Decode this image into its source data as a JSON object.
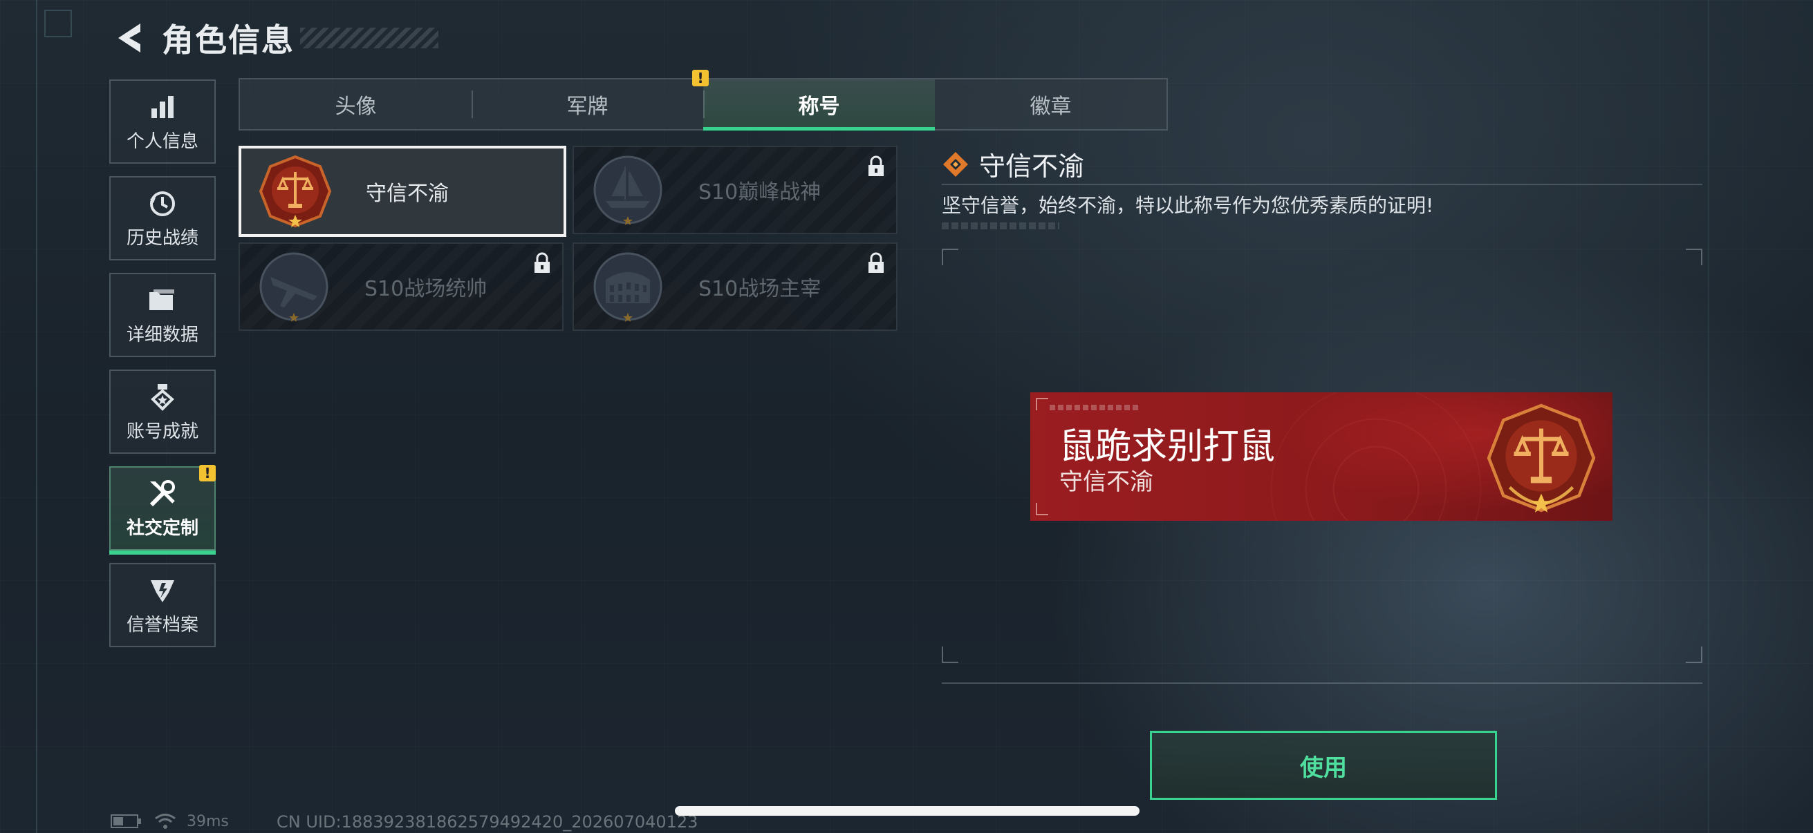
{
  "header": {
    "title": "角色信息"
  },
  "nav": {
    "items": [
      {
        "label": "个人信息",
        "icon": "bar-chart-icon",
        "active": false
      },
      {
        "label": "历史战绩",
        "icon": "history-clock-icon",
        "active": false
      },
      {
        "label": "详细数据",
        "icon": "folder-icon",
        "active": false
      },
      {
        "label": "账号成就",
        "icon": "achievement-icon",
        "active": false
      },
      {
        "label": "社交定制",
        "icon": "tools-icon",
        "active": true,
        "alert": "!"
      },
      {
        "label": "信誉档案",
        "icon": "credit-shield-icon",
        "active": false
      }
    ]
  },
  "tabs": [
    {
      "label": "头像",
      "active": false
    },
    {
      "label": "军牌",
      "active": false,
      "alert": "!"
    },
    {
      "label": "称号",
      "active": true
    },
    {
      "label": "徽章",
      "active": false
    }
  ],
  "titles": [
    {
      "label": "守信不渝",
      "emblem": "scales-emblem-icon",
      "locked": false,
      "selected": true
    },
    {
      "label": "S10巅峰战神",
      "emblem": "ship-emblem-icon",
      "locked": true,
      "selected": false
    },
    {
      "label": "S10战场统帅",
      "emblem": "plane-emblem-icon",
      "locked": true,
      "selected": false
    },
    {
      "label": "S10战场主宰",
      "emblem": "colosseum-emblem-icon",
      "locked": true,
      "selected": false
    }
  ],
  "detail": {
    "title": "守信不渝",
    "description": "坚守信誉，始终不渝，特以此称号作为您优秀素质的证明!"
  },
  "preview": {
    "player_name": "鼠跪求别打鼠",
    "title": "守信不渝"
  },
  "use_button": {
    "label": "使用"
  },
  "status_bar": {
    "ping": "39ms",
    "uid": "CN UID:1883923818625794924​20_202607040123"
  },
  "colors": {
    "accent": "#39d28e",
    "alert": "#f2c230",
    "banner_red": "#9a1d20"
  }
}
